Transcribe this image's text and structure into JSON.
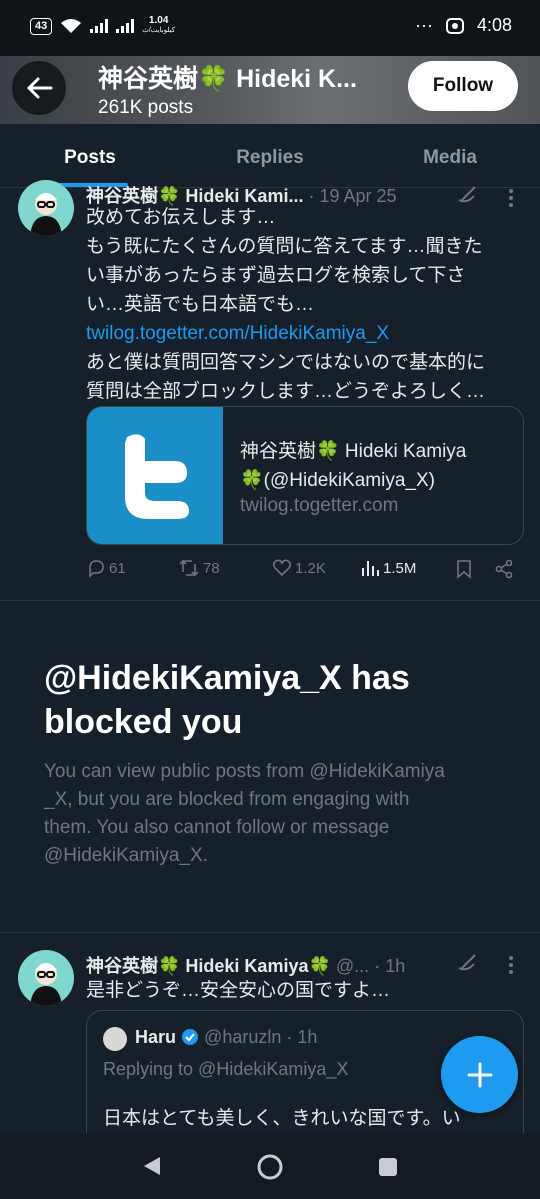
{
  "status_bar": {
    "battery": "43",
    "speed_top": "1.04",
    "speed_bottom": "كيلوبايت/ث",
    "dots": "···",
    "time": "4:08"
  },
  "header": {
    "name": "神谷英樹🍀 Hideki K...",
    "post_count": "261K posts",
    "follow_label": "Follow"
  },
  "tabs": [
    {
      "label": "Posts"
    },
    {
      "label": "Replies"
    },
    {
      "label": "Media"
    }
  ],
  "tweet1": {
    "name": "神谷英樹🍀 Hideki Kami...",
    "date": "· 19 Apr 25",
    "lines": [
      "改めてお伝えします…",
      "もう既にたくさんの質問に答えてます…聞きた",
      "い事があったらまず過去ログを検索して下さ",
      "い…英語でも日本語でも…"
    ],
    "link": "twilog.togetter.com/HidekiKamiya_X",
    "lines2": [
      "あと僕は質問回答マシンではないので基本的に",
      "質問は全部ブロックします…どうぞよろしく…"
    ],
    "card": {
      "title_line1": "神谷英樹🍀 Hideki Kamiya",
      "title_line2": "🍀(@HidekiKamiya_X)",
      "domain": "twilog.togetter.com"
    },
    "stats": {
      "replies": "61",
      "reposts": "78",
      "likes": "1.2K",
      "views": "1.5M"
    }
  },
  "blocked": {
    "title": "@HidekiKamiya_X has blocked you",
    "line1": "You can view public posts from @HidekiKamiya",
    "line2": "_X, but you are blocked from engaging with",
    "line3": "them. You also cannot follow or message",
    "line4": "@HidekiKamiya_X."
  },
  "tweet2": {
    "name": "神谷英樹🍀 Hideki Kamiya🍀",
    "handle": "@...",
    "time": "· 1h",
    "text": "是非どうぞ…安全安心の国ですよ…",
    "quote": {
      "name": "Haru",
      "handle": "@haruzln · 1h",
      "replying": "Replying to @HidekiKamiya_X",
      "text": "日本はとても美しく、きれいな国です。い"
    }
  },
  "colors": {
    "accent": "#1d9bf0",
    "background": "#15202b",
    "muted": "#71767b"
  }
}
